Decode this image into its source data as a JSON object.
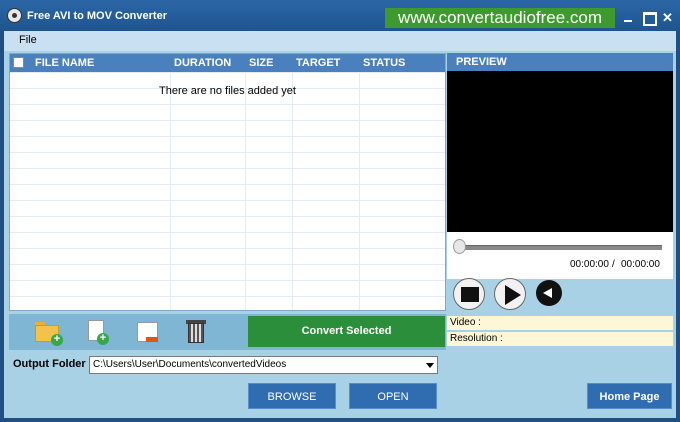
{
  "window": {
    "title": "Free AVI to MOV Converter",
    "brand_url": "www.convertaudiofree.com",
    "close_glyph": "✕"
  },
  "menu": {
    "file_label": "File"
  },
  "file_list": {
    "columns": [
      "FILE NAME",
      "DURATION",
      "SIZE",
      "TARGET",
      "STATUS"
    ],
    "empty_message": "There are no files added yet"
  },
  "toolbar": {
    "icons": [
      "add-folder-icon",
      "add-file-icon",
      "remove-file-icon",
      "trash-icon"
    ],
    "convert_label": "Convert Selected"
  },
  "output": {
    "label": "Output Folder",
    "path": "C:\\Users\\User\\Documents\\convertedVideos"
  },
  "buttons": {
    "browse": "BROWSE",
    "open": "OPEN",
    "home": "Home Page"
  },
  "preview": {
    "header": "PREVIEW",
    "current_time": "00:00:00",
    "separator": "/",
    "total_time": "00:00:00",
    "video_label": "Video :",
    "resolution_label": "Resolution :"
  },
  "colors": {
    "titlebar": "#1e558f",
    "brand_green": "#3e9a2f",
    "header_blue": "#4a80be",
    "convert_green": "#2b8e3a",
    "panel_bg": "#a9d1e5"
  }
}
